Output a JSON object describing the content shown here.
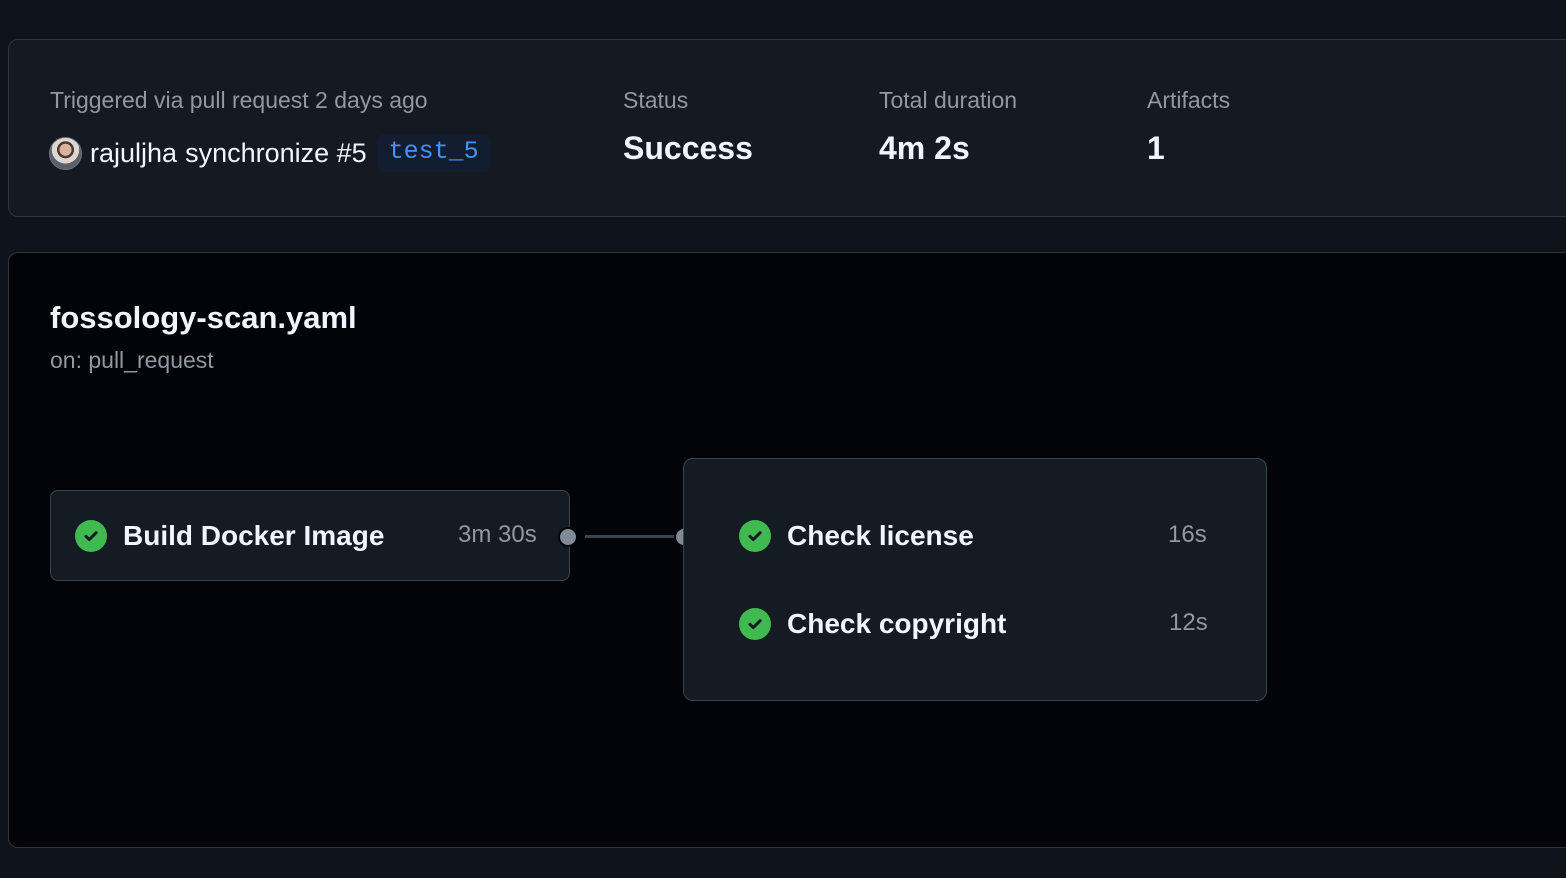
{
  "summary": {
    "trigger_label": "Triggered via pull request 2 days ago",
    "actor": "rajuljha",
    "event": "synchronize #5",
    "branch": "test_5",
    "status_label": "Status",
    "status_value": "Success",
    "duration_label": "Total duration",
    "duration_value": "4m 2s",
    "artifacts_label": "Artifacts",
    "artifacts_value": "1"
  },
  "workflow": {
    "title": "fossology-scan.yaml",
    "trigger": "on: pull_request",
    "jobs": [
      {
        "name": "Build Docker Image",
        "duration": "3m 30s",
        "status": "success"
      }
    ],
    "group_jobs": [
      {
        "name": "Check license",
        "duration": "16s",
        "status": "success"
      },
      {
        "name": "Check copyright",
        "duration": "12s",
        "status": "success"
      }
    ]
  },
  "icons": {
    "success": "check-circle-icon",
    "avatar": "user-avatar"
  },
  "colors": {
    "success": "#3fb950",
    "branch_text": "#4493f8",
    "background": "#0f131a"
  }
}
